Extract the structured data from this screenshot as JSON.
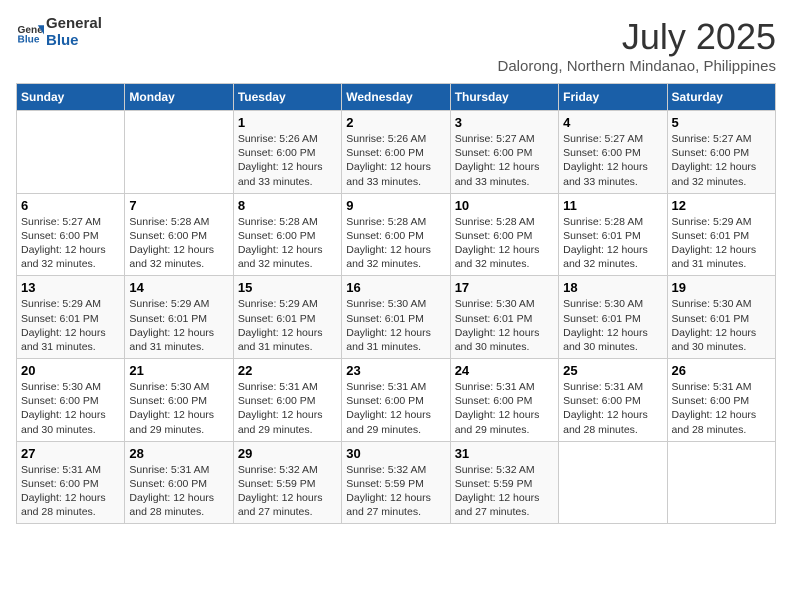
{
  "logo": {
    "line1": "General",
    "line2": "Blue"
  },
  "title": "July 2025",
  "subtitle": "Dalorong, Northern Mindanao, Philippines",
  "days_of_week": [
    "Sunday",
    "Monday",
    "Tuesday",
    "Wednesday",
    "Thursday",
    "Friday",
    "Saturday"
  ],
  "weeks": [
    [
      {
        "day": "",
        "info": ""
      },
      {
        "day": "",
        "info": ""
      },
      {
        "day": "1",
        "sunrise": "5:26 AM",
        "sunset": "6:00 PM",
        "daylight": "12 hours and 33 minutes."
      },
      {
        "day": "2",
        "sunrise": "5:26 AM",
        "sunset": "6:00 PM",
        "daylight": "12 hours and 33 minutes."
      },
      {
        "day": "3",
        "sunrise": "5:27 AM",
        "sunset": "6:00 PM",
        "daylight": "12 hours and 33 minutes."
      },
      {
        "day": "4",
        "sunrise": "5:27 AM",
        "sunset": "6:00 PM",
        "daylight": "12 hours and 33 minutes."
      },
      {
        "day": "5",
        "sunrise": "5:27 AM",
        "sunset": "6:00 PM",
        "daylight": "12 hours and 32 minutes."
      }
    ],
    [
      {
        "day": "6",
        "sunrise": "5:27 AM",
        "sunset": "6:00 PM",
        "daylight": "12 hours and 32 minutes."
      },
      {
        "day": "7",
        "sunrise": "5:28 AM",
        "sunset": "6:00 PM",
        "daylight": "12 hours and 32 minutes."
      },
      {
        "day": "8",
        "sunrise": "5:28 AM",
        "sunset": "6:00 PM",
        "daylight": "12 hours and 32 minutes."
      },
      {
        "day": "9",
        "sunrise": "5:28 AM",
        "sunset": "6:00 PM",
        "daylight": "12 hours and 32 minutes."
      },
      {
        "day": "10",
        "sunrise": "5:28 AM",
        "sunset": "6:00 PM",
        "daylight": "12 hours and 32 minutes."
      },
      {
        "day": "11",
        "sunrise": "5:28 AM",
        "sunset": "6:01 PM",
        "daylight": "12 hours and 32 minutes."
      },
      {
        "day": "12",
        "sunrise": "5:29 AM",
        "sunset": "6:01 PM",
        "daylight": "12 hours and 31 minutes."
      }
    ],
    [
      {
        "day": "13",
        "sunrise": "5:29 AM",
        "sunset": "6:01 PM",
        "daylight": "12 hours and 31 minutes."
      },
      {
        "day": "14",
        "sunrise": "5:29 AM",
        "sunset": "6:01 PM",
        "daylight": "12 hours and 31 minutes."
      },
      {
        "day": "15",
        "sunrise": "5:29 AM",
        "sunset": "6:01 PM",
        "daylight": "12 hours and 31 minutes."
      },
      {
        "day": "16",
        "sunrise": "5:30 AM",
        "sunset": "6:01 PM",
        "daylight": "12 hours and 31 minutes."
      },
      {
        "day": "17",
        "sunrise": "5:30 AM",
        "sunset": "6:01 PM",
        "daylight": "12 hours and 30 minutes."
      },
      {
        "day": "18",
        "sunrise": "5:30 AM",
        "sunset": "6:01 PM",
        "daylight": "12 hours and 30 minutes."
      },
      {
        "day": "19",
        "sunrise": "5:30 AM",
        "sunset": "6:01 PM",
        "daylight": "12 hours and 30 minutes."
      }
    ],
    [
      {
        "day": "20",
        "sunrise": "5:30 AM",
        "sunset": "6:00 PM",
        "daylight": "12 hours and 30 minutes."
      },
      {
        "day": "21",
        "sunrise": "5:30 AM",
        "sunset": "6:00 PM",
        "daylight": "12 hours and 29 minutes."
      },
      {
        "day": "22",
        "sunrise": "5:31 AM",
        "sunset": "6:00 PM",
        "daylight": "12 hours and 29 minutes."
      },
      {
        "day": "23",
        "sunrise": "5:31 AM",
        "sunset": "6:00 PM",
        "daylight": "12 hours and 29 minutes."
      },
      {
        "day": "24",
        "sunrise": "5:31 AM",
        "sunset": "6:00 PM",
        "daylight": "12 hours and 29 minutes."
      },
      {
        "day": "25",
        "sunrise": "5:31 AM",
        "sunset": "6:00 PM",
        "daylight": "12 hours and 28 minutes."
      },
      {
        "day": "26",
        "sunrise": "5:31 AM",
        "sunset": "6:00 PM",
        "daylight": "12 hours and 28 minutes."
      }
    ],
    [
      {
        "day": "27",
        "sunrise": "5:31 AM",
        "sunset": "6:00 PM",
        "daylight": "12 hours and 28 minutes."
      },
      {
        "day": "28",
        "sunrise": "5:31 AM",
        "sunset": "6:00 PM",
        "daylight": "12 hours and 28 minutes."
      },
      {
        "day": "29",
        "sunrise": "5:32 AM",
        "sunset": "5:59 PM",
        "daylight": "12 hours and 27 minutes."
      },
      {
        "day": "30",
        "sunrise": "5:32 AM",
        "sunset": "5:59 PM",
        "daylight": "12 hours and 27 minutes."
      },
      {
        "day": "31",
        "sunrise": "5:32 AM",
        "sunset": "5:59 PM",
        "daylight": "12 hours and 27 minutes."
      },
      {
        "day": "",
        "info": ""
      },
      {
        "day": "",
        "info": ""
      }
    ]
  ]
}
